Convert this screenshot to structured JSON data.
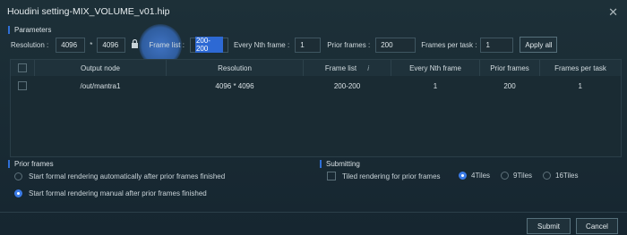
{
  "window": {
    "title": "Houdini setting-MIX_VOLUME_v01.hip",
    "close_glyph": "✕"
  },
  "parameters": {
    "section_label": "Parameters",
    "resolution_label": "Resolution :",
    "width": "4096",
    "times": "*",
    "height": "4096",
    "lock_icon": "lock-icon",
    "frame_list_label": "Frame list :",
    "frame_list": "200-200",
    "nth_label": "Every Nth frame :",
    "nth": "1",
    "prior_label": "Prior frames :",
    "prior": "200",
    "fpt_label": "Frames per task :",
    "fpt": "1",
    "apply_all": "Apply all"
  },
  "table": {
    "headers": [
      "Output node",
      "Resolution",
      "Frame list",
      "Every Nth frame",
      "Prior frames",
      "Frames per task"
    ],
    "frame_list_info_icon": "info-icon",
    "rows": [
      {
        "output_node": "/out/mantra1",
        "resolution": "4096 * 4096",
        "frame_list": "200-200",
        "nth": "1",
        "prior": "200",
        "fpt": "1"
      }
    ]
  },
  "prior_frames": {
    "section_label": "Prior frames",
    "options": [
      "Start formal rendering automatically after prior frames finished",
      "Start formal rendering manual after prior frames finished"
    ],
    "selected_index": 1
  },
  "submitting": {
    "section_label": "Submitting",
    "tiled_label": "Tiled rendering for prior frames",
    "tiles": [
      "4Tiles",
      "9Tiles",
      "16Tiles"
    ],
    "selected_tile_index": 0
  },
  "footer": {
    "submit": "Submit",
    "cancel": "Cancel"
  },
  "colors": {
    "accent": "#2f6fd6",
    "background": "#1a2a33"
  }
}
